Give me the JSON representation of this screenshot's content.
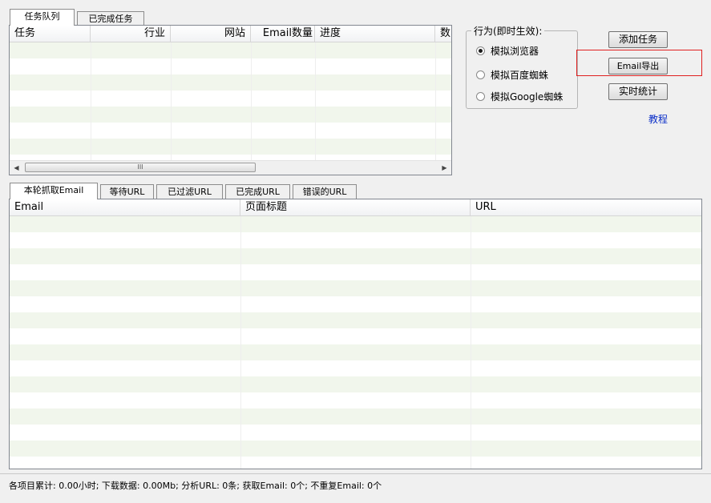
{
  "task_tabs": [
    "任务队列",
    "已完成任务"
  ],
  "task_table": {
    "columns": [
      "任务",
      "行业",
      "网站",
      "Email数量",
      "进度",
      "数"
    ],
    "rows": []
  },
  "behavior_group": {
    "title": "行为(即时生效):",
    "options": [
      "模拟浏览器",
      "模拟百度蜘蛛",
      "模拟Google蜘蛛"
    ],
    "selected_index": 0
  },
  "buttons": {
    "add_task": "添加任务",
    "email_export": "Email导出",
    "realtime_stats": "实时统计"
  },
  "tutorial_link": "教程",
  "result_tabs": [
    "本轮抓取Email",
    "等待URL",
    "已过滤URL",
    "已完成URL",
    "错误的URL"
  ],
  "result_table": {
    "columns": [
      "Email",
      "页面标题",
      "URL"
    ],
    "rows": []
  },
  "scroll_thumb_grip": "III",
  "scroll_left_arrow": "◀",
  "scroll_right_arrow": "▶",
  "status_text": "各项目累计: 0.00小时; 下载数据: 0.00Mb; 分析URL: 0条; 获取Email: 0个; 不重复Email: 0个",
  "colors": {
    "stripe": "#f1f6ec",
    "highlight": "#e02020",
    "link": "#0a2ec8"
  }
}
